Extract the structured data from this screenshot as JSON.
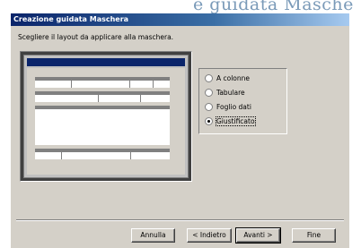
{
  "background_text": "e guidata Masche",
  "window": {
    "title": "Creazione guidata Maschera",
    "prompt": "Scegliere il layout da applicare alla maschera."
  },
  "layout_options": [
    {
      "label": "A colonne",
      "selected": false
    },
    {
      "label": "Tabulare",
      "selected": false
    },
    {
      "label": "Foglio dati",
      "selected": false
    },
    {
      "label": "Giustificato",
      "selected": true
    }
  ],
  "buttons": {
    "cancel": "Annulla",
    "back": "< Indietro",
    "next": "Avanti >",
    "finish": "Fine"
  },
  "colors": {
    "titlebar": "#0a246a",
    "dialog_face": "#d4d0c8",
    "preview_frame": "#404040"
  }
}
